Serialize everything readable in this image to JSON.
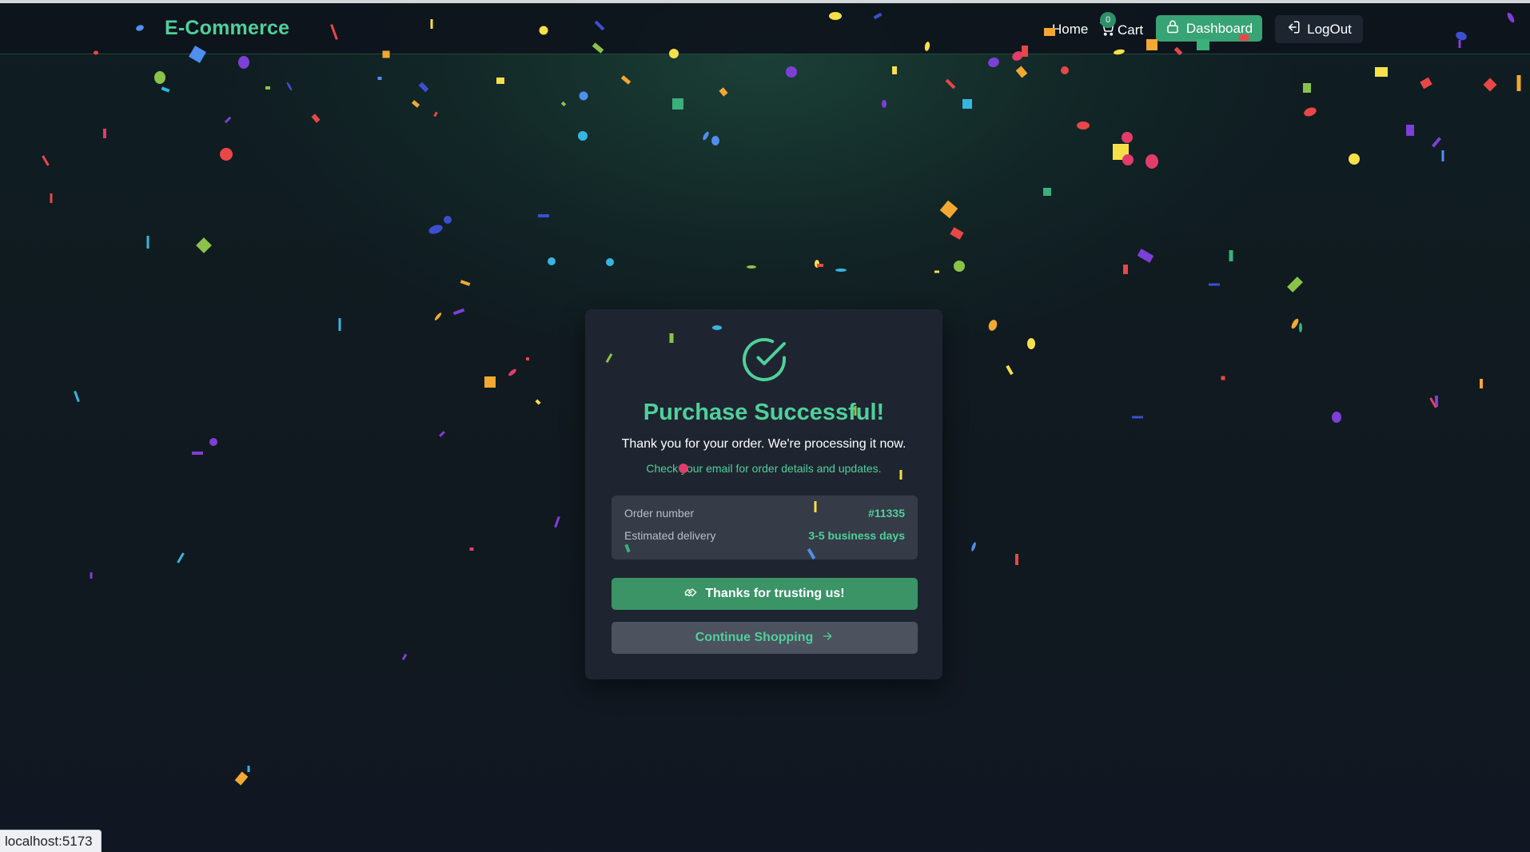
{
  "navbar": {
    "brand": "E-Commerce",
    "home_label": "Home",
    "cart_label": "Cart",
    "cart_count": "0",
    "dashboard_label": "Dashboard",
    "logout_label": "LogOut"
  },
  "success_card": {
    "title": "Purchase Successful!",
    "thanks_text": "Thank you for your order. We're processing it now.",
    "email_note": "Check your email for order details and updates.",
    "order_number_label": "Order number",
    "order_number_value": "#11335",
    "delivery_label": "Estimated delivery",
    "delivery_value": "3-5 business days",
    "thanks_button": "Thanks for trusting us!",
    "continue_button": "Continue Shopping"
  },
  "status_bar": {
    "url": "localhost:5173"
  },
  "colors": {
    "accent": "#4fd09b",
    "button_green": "#3a9466",
    "card_bg": "#1f2530",
    "confetti": [
      "#4f8ff0",
      "#f2a833",
      "#e94747",
      "#8bc34a",
      "#7e3fd6",
      "#36b5e0",
      "#f6e04a",
      "#e23c6b",
      "#3ab07a",
      "#3b4fd0"
    ]
  },
  "icons": {
    "success": "check-circle-icon",
    "cart": "cart-icon",
    "dashboard": "lock-icon",
    "logout": "logout-icon",
    "thanks": "handshake-icon",
    "continue": "arrow-right-icon"
  }
}
